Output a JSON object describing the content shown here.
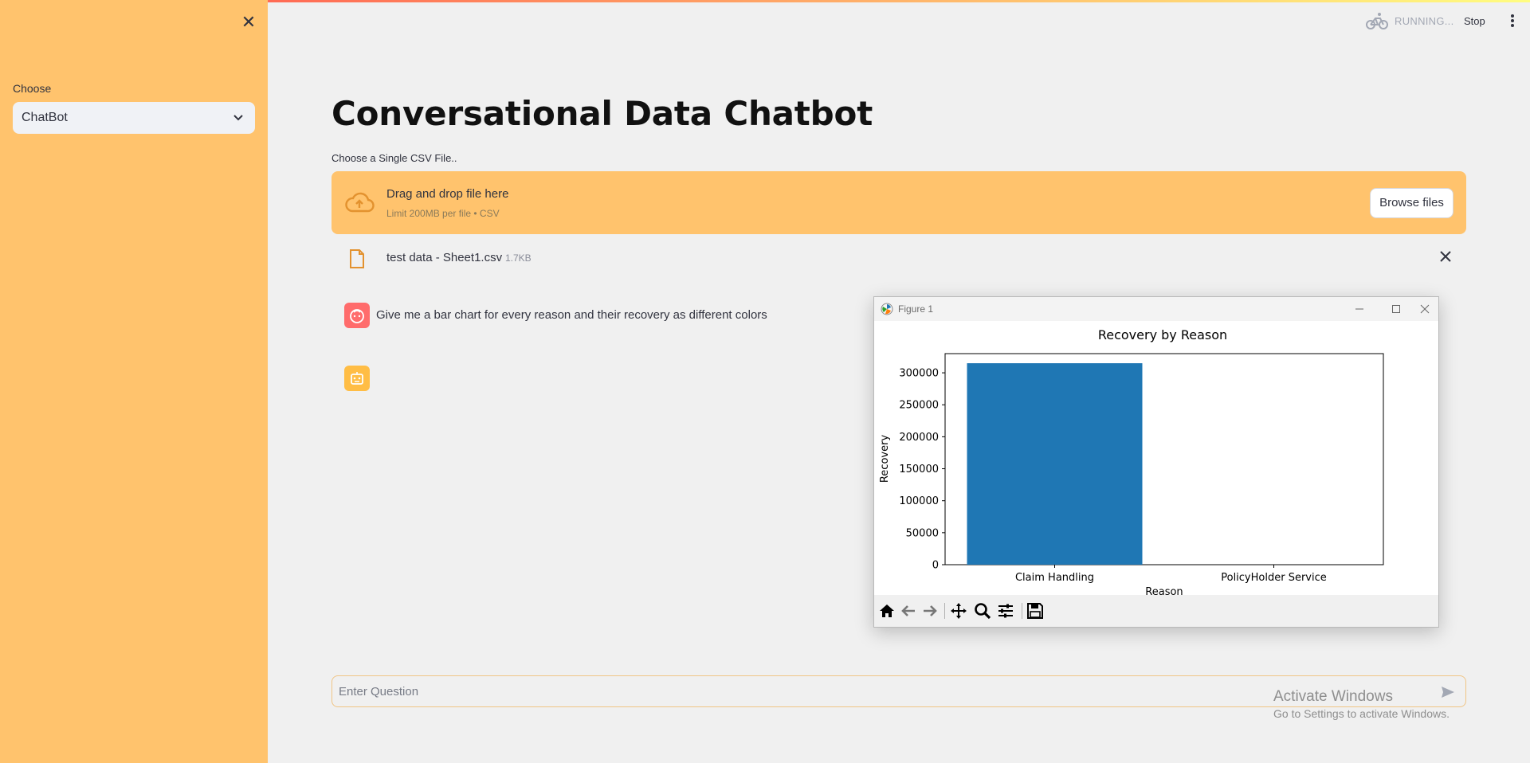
{
  "sidebar": {
    "close_label": "✕",
    "select_label": "Choose",
    "select_value": "ChatBot"
  },
  "status": {
    "running_text": "RUNNING...",
    "stop_label": "Stop"
  },
  "main": {
    "title": "Conversational Data Chatbot",
    "upload_label": "Choose a Single CSV File..",
    "dropzone_text": "Drag and drop file here",
    "dropzone_limit": "Limit 200MB per file • CSV",
    "browse_label": "Browse files",
    "file_name": "test data - Sheet1.csv",
    "file_size": "1.7KB",
    "user_message": "Give me a bar chart for every reason and their recovery as different colors",
    "input_placeholder": "Enter Question"
  },
  "figure_window": {
    "title": "Figure 1"
  },
  "watermark": {
    "line1": "Activate Windows",
    "line2": "Go to Settings to activate Windows."
  },
  "colors": {
    "sidebar": "#ffc36d",
    "bar": "#1f77b4",
    "user_avatar": "#ff6c6c",
    "bot_avatar": "#ffbd45"
  },
  "chart_data": {
    "type": "bar",
    "title": "Recovery by Reason",
    "xlabel": "Reason",
    "ylabel": "Recovery",
    "categories": [
      "Claim Handling",
      "PolicyHolder Service"
    ],
    "values": [
      315000,
      0
    ],
    "ylim": [
      0,
      330000
    ],
    "yticks": [
      0,
      50000,
      100000,
      150000,
      200000,
      250000,
      300000
    ],
    "ytick_labels": [
      "0",
      "50000",
      "100000",
      "150000",
      "200000",
      "250000",
      "300000"
    ],
    "grid": false
  }
}
